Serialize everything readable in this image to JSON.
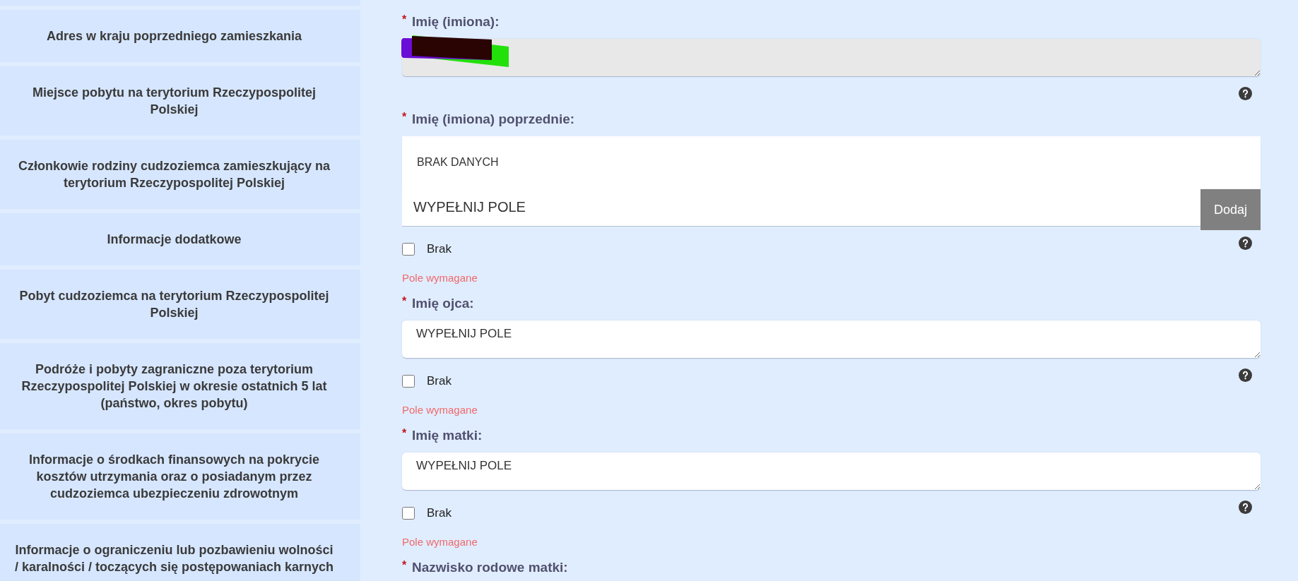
{
  "sidebar": {
    "items": [
      {
        "label": "Adres w kraju poprzedniego zamieszkania",
        "selected": false
      },
      {
        "label": "Miejsce pobytu na terytorium Rzeczypospolitej Polskiej",
        "selected": false
      },
      {
        "label": "Członkowie rodziny cudzoziemca zamieszkujący na terytorium Rzeczypospolitej Polskiej",
        "selected": false
      },
      {
        "label": "Informacje dodatkowe",
        "selected": false
      },
      {
        "label": "Pobyt cudzoziemca na terytorium Rzeczypospolitej Polskiej",
        "selected": false
      },
      {
        "label": "Podróże i pobyty zagraniczne poza terytorium Rzeczypospolitej Polskiej w okresie ostatnich 5 lat (państwo, okres pobytu)",
        "selected": false
      },
      {
        "label": "Informacje o środkach finansowych na pokrycie kosztów utrzymania oraz o posiadanym przez cudzoziemca ubezpieczeniu zdrowotnym",
        "selected": false
      },
      {
        "label": "Informacje o ograniczeniu lub pozbawieniu wolności / karalności / toczących się postępowaniach karnych",
        "selected": false
      }
    ]
  },
  "form": {
    "fields": [
      {
        "kind": "textarea",
        "required_mark": "*",
        "label": "Imię (imiona):",
        "disabled": true,
        "redacted": true,
        "help": true
      },
      {
        "kind": "list",
        "required_mark": "*",
        "label": "Imię (imiona) poprzednie:",
        "entries": [
          "BRAK DANYCH"
        ],
        "value": "WYPEŁNIJ POLE",
        "add_button": "Dodaj",
        "help": true,
        "none_option": {
          "label": "Brak",
          "checked": false
        },
        "error": "Pole wymagane"
      },
      {
        "kind": "textarea",
        "required_mark": "*",
        "label": "Imię ojca:",
        "disabled": false,
        "value": "WYPEŁNIJ POLE",
        "help": true,
        "none_option": {
          "label": "Brak",
          "checked": false
        },
        "error": "Pole wymagane"
      },
      {
        "kind": "textarea",
        "required_mark": "*",
        "label": "Imię matki:",
        "disabled": false,
        "value": "WYPEŁNIJ POLE",
        "help": true,
        "none_option": {
          "label": "Brak",
          "checked": false
        },
        "error": "Pole wymagane"
      },
      {
        "kind": "heading",
        "required_mark": "*",
        "label": "Nazwisko rodowe matki:"
      }
    ]
  }
}
